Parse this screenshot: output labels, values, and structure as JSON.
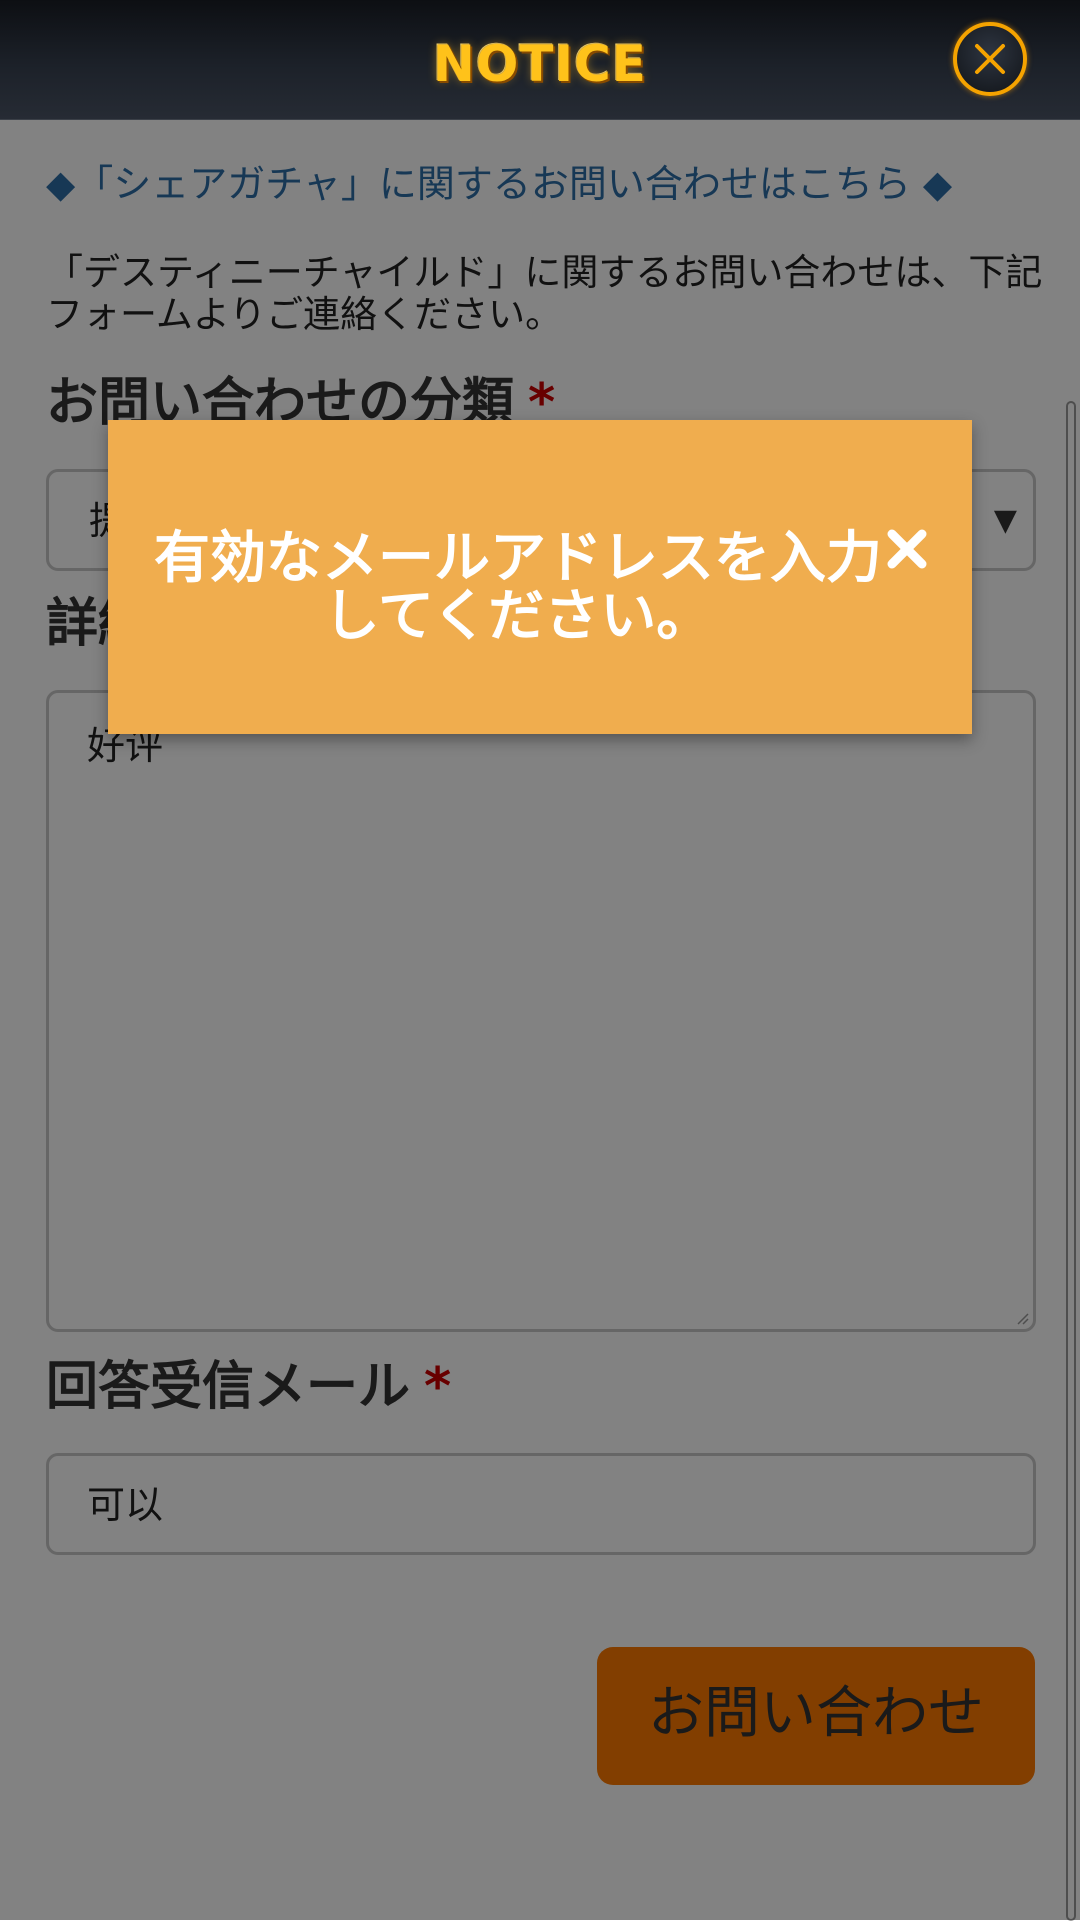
{
  "header": {
    "title": "NOTICE",
    "close_icon": "close-circle-icon",
    "accent": "#f5a300"
  },
  "content": {
    "share_link": "◆「シェアガチャ」に関するお問い合わせはこちら ◆",
    "intro": "「デスティニーチャイルド」に関するお問い合わせは、下記フォームよりご連絡ください。",
    "category": {
      "label": "お問い合わせの分類",
      "required_mark": "*",
      "selected_value": "提",
      "arrow": "▼"
    },
    "details": {
      "label": "詳細",
      "required_mark": "*",
      "value": "好评"
    },
    "email": {
      "label": "回答受信メール",
      "required_mark": "*",
      "value": "可以"
    },
    "submit_label": "お問い合わせ",
    "colors": {
      "link": "#2d6ea8",
      "submit": "#ff7a00",
      "required": "#cc0000"
    }
  },
  "toast": {
    "message": "有効なメールアドレスを入力してください。",
    "close_icon": "close-x-icon",
    "background": "#f0ad4e"
  }
}
